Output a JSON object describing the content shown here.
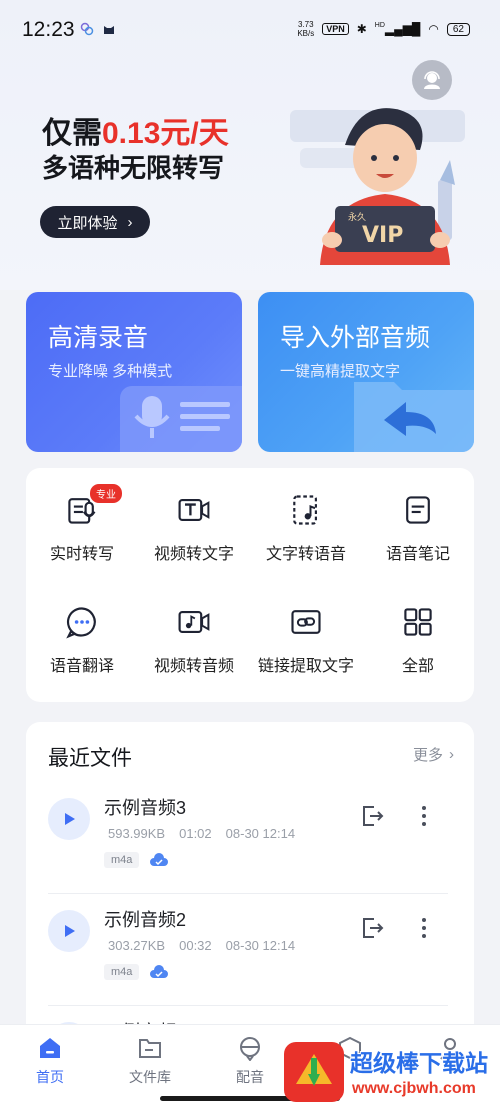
{
  "status_bar": {
    "time": "12:23",
    "net_speed_value": "3.73",
    "net_speed_unit": "KB/s",
    "vpn": "VPN",
    "hd": "HD",
    "battery": "62"
  },
  "promo": {
    "line1_prefix": "仅需",
    "line1_price": "0.13元/天",
    "line2": "多语种无限转写",
    "cta": "立即体验",
    "vip_small": "永久",
    "vip_big": "VIP"
  },
  "cards": {
    "record": {
      "title": "高清录音",
      "subtitle": "专业降噪 多种模式"
    },
    "import": {
      "title": "导入外部音频",
      "subtitle": "一键高精提取文字"
    }
  },
  "tools": [
    {
      "label": "实时转写",
      "badge": "专业",
      "icon": "mic-doc-icon"
    },
    {
      "label": "视频转文字",
      "icon": "video-text-icon"
    },
    {
      "label": "文字转语音",
      "icon": "text-to-speech-icon"
    },
    {
      "label": "语音笔记",
      "icon": "note-icon"
    },
    {
      "label": "语音翻译",
      "icon": "chat-bubble-icon"
    },
    {
      "label": "视频转音频",
      "icon": "video-audio-icon"
    },
    {
      "label": "链接提取文字",
      "icon": "link-icon"
    },
    {
      "label": "全部",
      "icon": "grid-icon"
    }
  ],
  "recent": {
    "title": "最近文件",
    "more": "更多",
    "files": [
      {
        "name": "示例音频3",
        "size": "593.99KB",
        "duration": "01:02",
        "date": "08-30 12:14",
        "format": "m4a"
      },
      {
        "name": "示例音频2",
        "size": "303.27KB",
        "duration": "00:32",
        "date": "08-30 12:14",
        "format": "m4a"
      },
      {
        "name": "示例音频"
      }
    ]
  },
  "tabbar": [
    {
      "label": "首页",
      "active": true,
      "icon": "home-icon"
    },
    {
      "label": "文件库",
      "icon": "folder-icon"
    },
    {
      "label": "配音",
      "icon": "dubbing-icon"
    },
    {
      "label": "",
      "icon": "box-icon"
    },
    {
      "label": "",
      "icon": "profile-icon"
    }
  ],
  "watermark": {
    "text": "超级棒下载站",
    "url": "www.cjbwh.com"
  },
  "colors": {
    "accent": "#3f6ef4",
    "price_red": "#e8312a",
    "cta_dark": "#1f2333"
  }
}
